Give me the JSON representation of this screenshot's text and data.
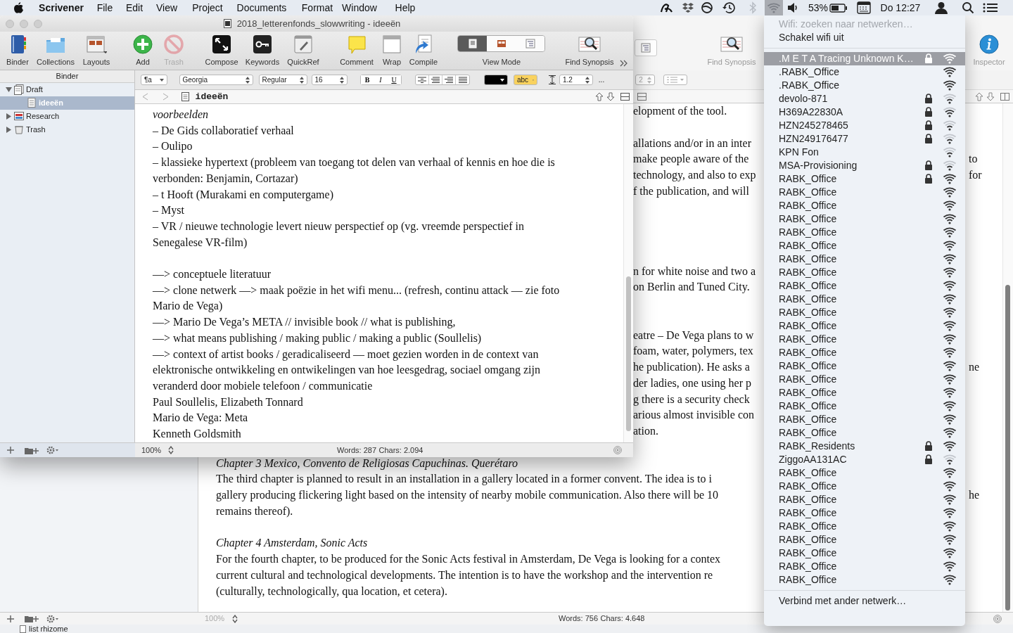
{
  "menubar": {
    "app": "Scrivener",
    "menus": [
      "File",
      "Edit",
      "View",
      "Project",
      "Documents",
      "Format",
      "Window",
      "Help"
    ],
    "battery": "53%",
    "clock": "Do 12:27"
  },
  "back_window": {
    "toolbar": [
      {
        "label": "Find Synopsis",
        "kind": "find"
      },
      {
        "label": "Inspector",
        "kind": "inspector"
      }
    ],
    "format_bar": {
      "line_spacing": "2"
    },
    "editor": {
      "paragraphs": [
        {
          "kind": "strip",
          "lines": [
            {
              "text": "elopment of the tool.",
              "kind": "body"
            }
          ]
        },
        {
          "kind": "strip",
          "lines": [
            {
              "text": "allations and/or in an inter",
              "kind": "body"
            },
            {
              "text": "make people aware of the",
              "kind": "body",
              "right": "to"
            },
            {
              "text": "technology, and also to exp",
              "kind": "body",
              "right": "for"
            },
            {
              "text": "f the publication, and will",
              "kind": "body"
            }
          ]
        },
        {
          "kind": "strip",
          "lines": [
            {
              "text": "n for white noise and two a",
              "kind": "body"
            },
            {
              "text": "on Berlin and Tuned City.",
              "kind": "body"
            }
          ]
        },
        {
          "kind": "strip",
          "lines": [
            {
              "text": "eatre – De Vega plans to w",
              "kind": "body"
            },
            {
              "text": "foam, water, polymers, tex",
              "kind": "body"
            },
            {
              "text": "he publication). He asks a",
              "kind": "body",
              "right": "ne"
            },
            {
              "text": "der ladies, one using her p",
              "kind": "body"
            },
            {
              "text": "g there is a security check",
              "kind": "body"
            },
            {
              "text": "arious almost invisible con",
              "kind": "body"
            },
            {
              "text": "ation.",
              "kind": "body"
            }
          ]
        },
        {
          "kind": "full",
          "lines": [
            {
              "text": "Chapter 3 Mexico, Convento de Religiosas Capuchinas. Querétaro",
              "kind": "heading"
            },
            {
              "text": "The third chapter is planned to result in an installation in a gallery located in a former convent. The idea is to i",
              "kind": "body"
            },
            {
              "text": "gallery producing flickering light based on the intensity of nearby mobile communication. Also there will be 10",
              "kind": "body",
              "right": "he"
            },
            {
              "text": "remains thereof).",
              "kind": "body"
            }
          ]
        },
        {
          "kind": "full",
          "lines": [
            {
              "text": "Chapter 4 Amsterdam, Sonic Acts",
              "kind": "heading"
            },
            {
              "text": "For the fourth chapter, to be produced for the Sonic Acts festival in Amsterdam, De Vega is looking for a contex",
              "kind": "body"
            },
            {
              "text": "current cultural and technological developments. The intention is to have the workshop and the intervention re",
              "kind": "body"
            },
            {
              "text": "(culturally, technologically, qua location, et cetera).",
              "kind": "body"
            }
          ]
        }
      ]
    },
    "footer": {
      "zoom": "100%",
      "words": "Words: 756",
      "chars": "Chars: 4.648"
    },
    "binder_items": [
      {
        "label": "list rhizome"
      }
    ]
  },
  "front_window": {
    "title": "2018_letterenfonds_slowwriting - ideeën",
    "toolbar": [
      {
        "label": "Binder",
        "kind": "binder",
        "disabled": false
      },
      {
        "label": "Collections",
        "kind": "collections",
        "disabled": false
      },
      {
        "label": "Layouts",
        "kind": "layouts",
        "disabled": false
      },
      {
        "label": "Add",
        "kind": "add",
        "disabled": false
      },
      {
        "label": "Trash",
        "kind": "trash",
        "disabled": true
      },
      {
        "label": "Compose",
        "kind": "compose",
        "disabled": false
      },
      {
        "label": "Keywords",
        "kind": "keywords",
        "disabled": false
      },
      {
        "label": "QuickRef",
        "kind": "quickref",
        "disabled": false
      },
      {
        "label": "Comment",
        "kind": "comment",
        "disabled": false
      },
      {
        "label": "Wrap",
        "kind": "wrap",
        "disabled": false
      },
      {
        "label": "Compile",
        "kind": "compile",
        "disabled": false
      },
      {
        "label": "View Mode",
        "kind": "viewmode",
        "disabled": false,
        "segments": [
          {
            "kind": "page",
            "selected": true
          },
          {
            "kind": "corkboard",
            "selected": false
          },
          {
            "kind": "outline",
            "selected": false
          }
        ]
      },
      {
        "label": "Find Synopsis",
        "kind": "find",
        "disabled": false
      }
    ],
    "format_bar": {
      "paragraph_style": "¶a",
      "font": "Georgia",
      "typeface": "Regular",
      "size": "16",
      "styles": [
        {
          "label": "B",
          "kind": "bold"
        },
        {
          "label": "I",
          "kind": "italic"
        },
        {
          "label": "U",
          "kind": "underline"
        }
      ],
      "highlight": "abc",
      "line_spacing": "1.2",
      "more": "..."
    },
    "binder": {
      "title": "Binder",
      "items": [
        {
          "label": "Draft",
          "kind": "draft",
          "expanded": true,
          "selected": false,
          "children": [
            {
              "label": "ideeën",
              "kind": "doc",
              "selected": true
            }
          ]
        },
        {
          "label": "Research",
          "kind": "research",
          "expanded": false,
          "selected": false
        },
        {
          "label": "Trash",
          "kind": "trash",
          "expanded": false,
          "selected": false
        }
      ]
    },
    "editor": {
      "title": "ideeën",
      "sections": [
        [
          {
            "kind": "heading",
            "lines": [
              "voorbeelden"
            ]
          },
          {
            "kind": "body",
            "lines": [
              "– De Gids collaboratief verhaal"
            ]
          },
          {
            "kind": "body",
            "lines": [
              "– Oulipo"
            ]
          },
          {
            "kind": "body",
            "lines": [
              "– klassieke hypertext (probleem van toegang tot delen van verhaal of kennis en hoe die is",
              "verbonden: Benjamin, Cortazar)"
            ]
          },
          {
            "kind": "body",
            "lines": [
              "– t Hooft (Murakami en computergame)"
            ]
          },
          {
            "kind": "body",
            "lines": [
              "– Myst"
            ]
          },
          {
            "kind": "body",
            "lines": [
              "– VR / nieuwe technologie levert nieuw perspectief op (vg. vreemde perspectief in",
              "Senegalese VR-film)"
            ]
          }
        ],
        [
          {
            "kind": "body",
            "lines": [
              "—> conceptuele literatuur"
            ]
          },
          {
            "kind": "body",
            "lines": [
              "—> clone netwerk —> maak poëzie in het wifi menu... (refresh, continu attack — zie foto",
              "Mario de Vega)"
            ]
          },
          {
            "kind": "body",
            "lines": [
              "—> Mario De Vega’s META // invisible book // what is publishing,"
            ]
          },
          {
            "kind": "body",
            "lines": [
              "—> what means publishing / making public / making a public (Soullelis)"
            ]
          },
          {
            "kind": "body",
            "lines": [
              "—> context of artist books / geradicaliseerd — moet gezien worden in de context van",
              "elektronische ontwikkeling en ontwikelingen van hoe leesgedrag, sociael omgang zijn",
              "veranderd door mobiele telefoon / communicatie"
            ]
          },
          {
            "kind": "body",
            "lines": [
              "Paul Soullelis, Elizabeth Tonnard"
            ]
          },
          {
            "kind": "body",
            "lines": [
              "Mario de Vega: Meta"
            ]
          },
          {
            "kind": "body",
            "lines": [
              "Kenneth Goldsmith"
            ]
          }
        ]
      ]
    },
    "footer": {
      "zoom": "100%",
      "words": "Words: 287",
      "chars": "Chars: 2.094"
    }
  },
  "wifi_menu": {
    "status": "Wifi: zoeken naar netwerken…",
    "toggle": "Schakel wifi uit",
    "networks": [
      {
        "name": ".M E T A Tracing Unknown K…",
        "locked": true,
        "kind": "strong",
        "selected": true
      },
      {
        "name": ".RABK_Office",
        "locked": false,
        "kind": "strong",
        "selected": false
      },
      {
        "name": ".RABK_Office",
        "locked": false,
        "kind": "strong",
        "selected": false
      },
      {
        "name": "devolo-871",
        "locked": true,
        "kind": "weak",
        "selected": false
      },
      {
        "name": "H369A22830A",
        "locked": true,
        "kind": "medium",
        "selected": false
      },
      {
        "name": "HZN245278465",
        "locked": true,
        "kind": "weak",
        "selected": false
      },
      {
        "name": "HZN249176477",
        "locked": true,
        "kind": "weak",
        "selected": false
      },
      {
        "name": "KPN Fon",
        "locked": false,
        "kind": "weak",
        "selected": false
      },
      {
        "name": "MSA-Provisioning",
        "locked": true,
        "kind": "weak",
        "selected": false
      },
      {
        "name": "RABK_Office",
        "locked": true,
        "kind": "strong",
        "selected": false
      },
      {
        "name": "RABK_Office",
        "locked": false,
        "kind": "strong",
        "selected": false
      },
      {
        "name": "RABK_Office",
        "locked": false,
        "kind": "strong",
        "selected": false
      },
      {
        "name": "RABK_Office",
        "locked": false,
        "kind": "strong",
        "selected": false
      },
      {
        "name": "RABK_Office",
        "locked": false,
        "kind": "strong",
        "selected": false
      },
      {
        "name": "RABK_Office",
        "locked": false,
        "kind": "strong",
        "selected": false
      },
      {
        "name": "RABK_Office",
        "locked": false,
        "kind": "strong",
        "selected": false
      },
      {
        "name": "RABK_Office",
        "locked": false,
        "kind": "strong",
        "selected": false
      },
      {
        "name": "RABK_Office",
        "locked": false,
        "kind": "strong",
        "selected": false
      },
      {
        "name": "RABK_Office",
        "locked": false,
        "kind": "strong",
        "selected": false
      },
      {
        "name": "RABK_Office",
        "locked": false,
        "kind": "strong",
        "selected": false
      },
      {
        "name": "RABK_Office",
        "locked": false,
        "kind": "strong",
        "selected": false
      },
      {
        "name": "RABK_Office",
        "locked": false,
        "kind": "strong",
        "selected": false
      },
      {
        "name": "RABK_Office",
        "locked": false,
        "kind": "strong",
        "selected": false
      },
      {
        "name": "RABK_Office",
        "locked": false,
        "kind": "strong",
        "selected": false
      },
      {
        "name": "RABK_Office",
        "locked": false,
        "kind": "strong",
        "selected": false
      },
      {
        "name": "RABK_Office",
        "locked": false,
        "kind": "strong",
        "selected": false
      },
      {
        "name": "RABK_Office",
        "locked": false,
        "kind": "strong",
        "selected": false
      },
      {
        "name": "RABK_Office",
        "locked": false,
        "kind": "strong",
        "selected": false
      },
      {
        "name": "RABK_Office",
        "locked": false,
        "kind": "strong",
        "selected": false
      },
      {
        "name": "RABK_Residents",
        "locked": true,
        "kind": "strong",
        "selected": false
      },
      {
        "name": "ZiggoAA131AC",
        "locked": true,
        "kind": "weak",
        "selected": false
      },
      {
        "name": "RABK_Office",
        "locked": false,
        "kind": "strong",
        "selected": false
      },
      {
        "name": "RABK_Office",
        "locked": false,
        "kind": "strong",
        "selected": false
      },
      {
        "name": "RABK_Office",
        "locked": false,
        "kind": "strong",
        "selected": false
      },
      {
        "name": "RABK_Office",
        "locked": false,
        "kind": "strong",
        "selected": false
      },
      {
        "name": "RABK_Office",
        "locked": false,
        "kind": "strong",
        "selected": false
      },
      {
        "name": "RABK_Office",
        "locked": false,
        "kind": "strong",
        "selected": false
      },
      {
        "name": "RABK_Office",
        "locked": false,
        "kind": "strong",
        "selected": false
      },
      {
        "name": "RABK_Office",
        "locked": false,
        "kind": "strong",
        "selected": false
      },
      {
        "name": "RABK_Office",
        "locked": false,
        "kind": "strong",
        "selected": false
      }
    ],
    "other": "Verbind met ander netwerk…"
  }
}
